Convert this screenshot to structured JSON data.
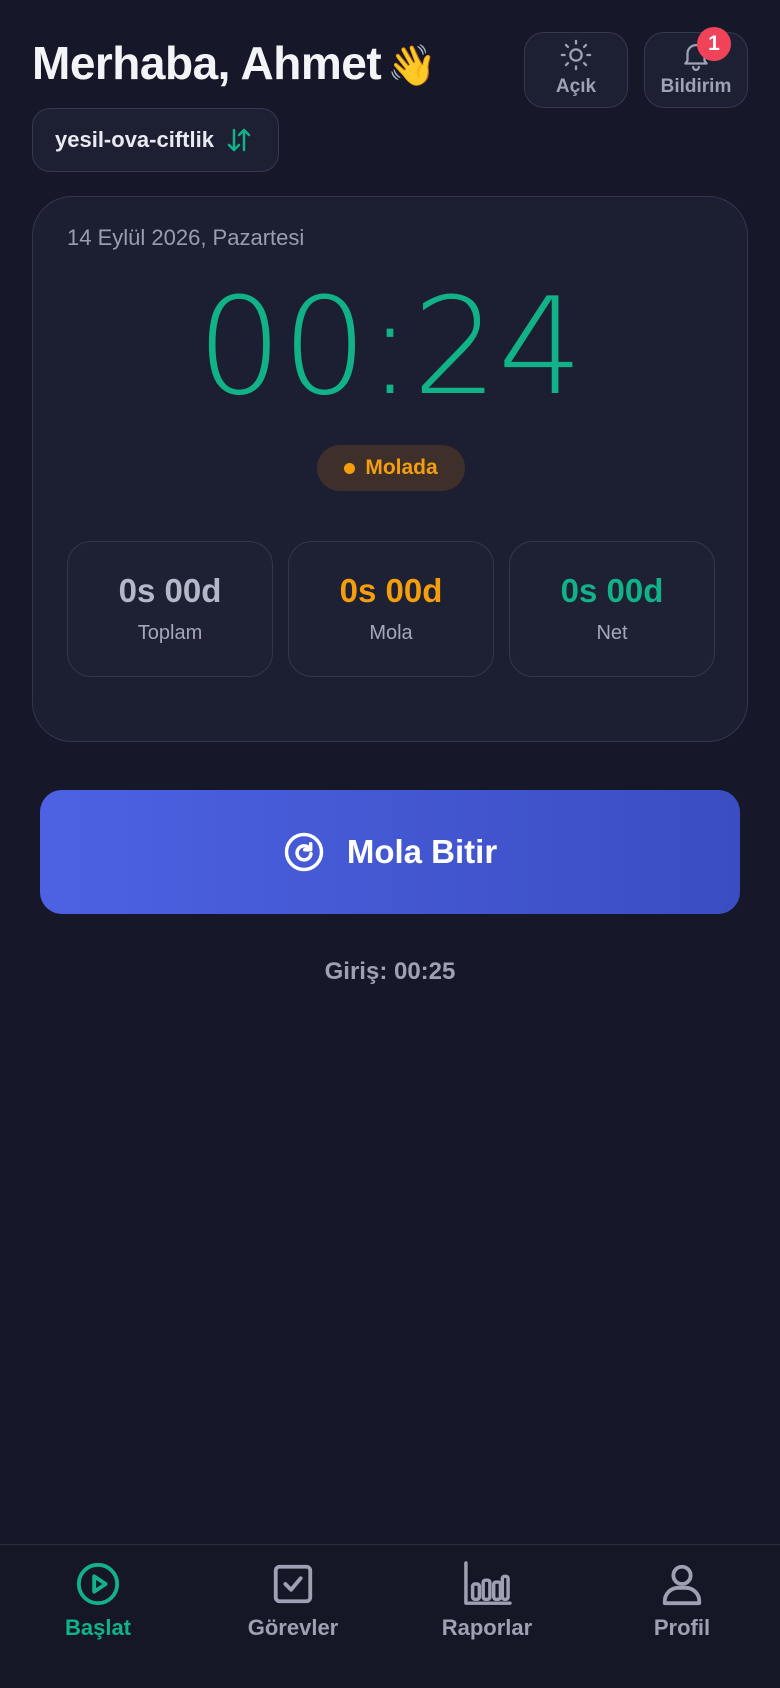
{
  "header": {
    "greeting": "Merhaba, Ahmet",
    "wave_emoji": "👋",
    "theme_button": {
      "label": "Açık",
      "icon": "sun-icon"
    },
    "notification_button": {
      "label": "Bildirim",
      "icon": "bell-icon",
      "badge": "1"
    }
  },
  "farm_selector": {
    "name": "yesil-ova-ciftlik",
    "icon": "swap-arrows-icon"
  },
  "session_card": {
    "date": "14 Eylül 2026, Pazartesi",
    "timer": "00:24",
    "status": "Molada",
    "stats": [
      {
        "value": "0s 00d",
        "label": "Toplam"
      },
      {
        "value": "0s 00d",
        "label": "Mola"
      },
      {
        "value": "0s 00d",
        "label": "Net"
      }
    ]
  },
  "primary_action": {
    "label": "Mola Bitir",
    "icon": "refresh-circle-icon"
  },
  "checkin_text": "Giriş: 00:25",
  "bottom_nav": [
    {
      "label": "Başlat",
      "icon": "play-circle-icon",
      "active": true
    },
    {
      "label": "Görevler",
      "icon": "checkbox-icon",
      "active": false
    },
    {
      "label": "Raporlar",
      "icon": "bar-chart-icon",
      "active": false
    },
    {
      "label": "Profil",
      "icon": "user-icon",
      "active": false
    }
  ],
  "colors": {
    "background": "#161829",
    "accent_green": "#12b289",
    "accent_orange": "#f59e0b",
    "accent_blue": "#4c62e2",
    "badge_red": "#f0435a"
  }
}
